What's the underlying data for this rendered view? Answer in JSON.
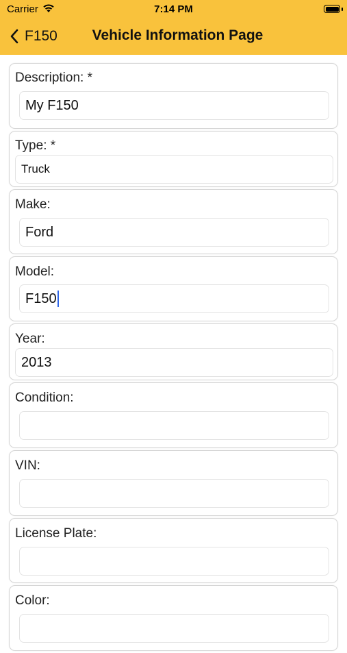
{
  "status_bar": {
    "carrier": "Carrier",
    "time": "7:14 PM"
  },
  "nav": {
    "back_label": "F150",
    "title": "Vehicle Information Page"
  },
  "fields": {
    "description": {
      "label": "Description: *",
      "value": "My F150"
    },
    "type": {
      "label": "Type: *",
      "value": "Truck"
    },
    "make": {
      "label": "Make:",
      "value": "Ford"
    },
    "model": {
      "label": "Model:",
      "value": "F150"
    },
    "year": {
      "label": "Year:",
      "value": "2013"
    },
    "condition": {
      "label": "Condition:",
      "value": ""
    },
    "vin": {
      "label": "VIN:",
      "value": ""
    },
    "license_plate": {
      "label": "License Plate:",
      "value": ""
    },
    "color": {
      "label": "Color:",
      "value": ""
    }
  },
  "colors": {
    "header": "#f9c23c",
    "caret": "#2f66e8"
  }
}
